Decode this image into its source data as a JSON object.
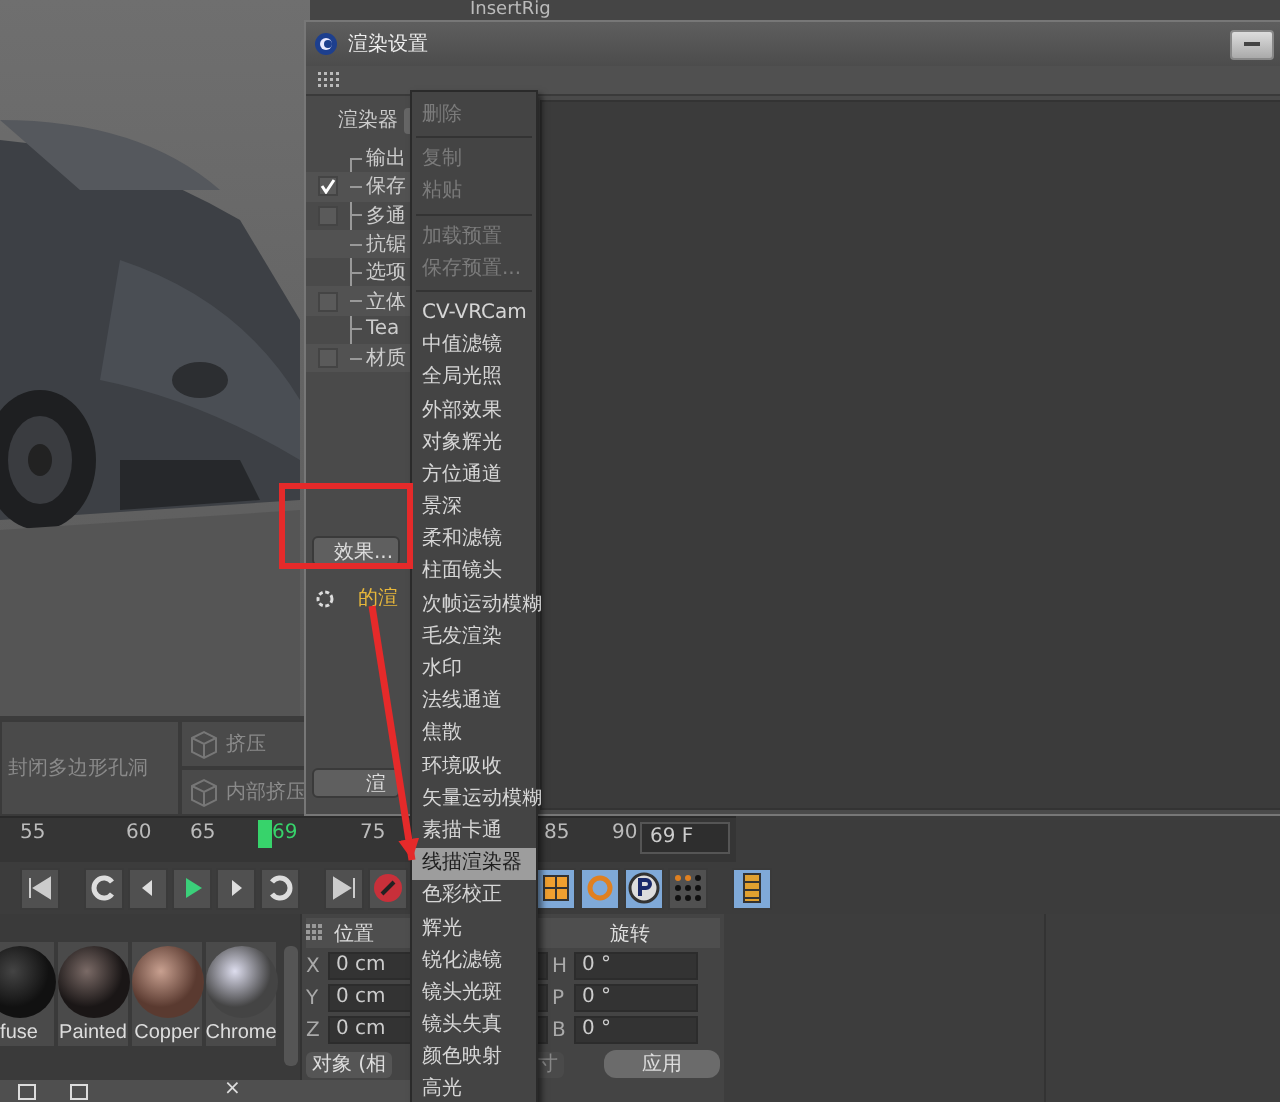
{
  "background_panel": {
    "label": "InsertRig"
  },
  "tool_buttons": [
    {
      "label": "封闭多边形孔洞"
    },
    {
      "label": "挤压"
    },
    {
      "label": "内部挤压"
    }
  ],
  "timeline": {
    "ticks": [
      "55",
      "60",
      "65",
      "75",
      "85",
      "90"
    ],
    "current_frame": "69",
    "frame_field": "69 F"
  },
  "materials": [
    {
      "name": "fuse"
    },
    {
      "name": "Painted"
    },
    {
      "name": "Copper"
    },
    {
      "name": "Chrome"
    }
  ],
  "coordinates": {
    "position_header": "位置",
    "rotation_header": "旋转",
    "position_rows": [
      {
        "axis": "X",
        "value": "0 cm"
      },
      {
        "axis": "Y",
        "value": "0 cm"
      },
      {
        "axis": "Z",
        "value": "0 cm"
      }
    ],
    "rotation_rows": [
      {
        "axis": "H",
        "value": "0 °"
      },
      {
        "axis": "P",
        "value": "0 °"
      },
      {
        "axis": "B",
        "value": "0 °"
      }
    ],
    "mode_dropdown": "对象 (相",
    "size_dropdown": "寸",
    "apply_button": "应用"
  },
  "bottom_tabs": {
    "close": "×"
  },
  "render_settings": {
    "title": "渲染设置",
    "renderer_label": "渲染器",
    "tree": [
      {
        "label": "输出",
        "kind": "plain"
      },
      {
        "label": "保存",
        "kind": "checkbox",
        "checked": true
      },
      {
        "label": "多通",
        "kind": "checkbox",
        "checked": false
      },
      {
        "label": "抗锯",
        "kind": "plain"
      },
      {
        "label": "选项",
        "kind": "plain"
      },
      {
        "label": "立体",
        "kind": "checkbox",
        "checked": false
      },
      {
        "label": "Tea",
        "kind": "plain"
      },
      {
        "label": "材质",
        "kind": "checkbox",
        "checked": false
      }
    ],
    "effect_button": "效果...",
    "effect_item": "的渲",
    "render_button": "渲"
  },
  "context_menu": {
    "items": [
      {
        "label": "删除",
        "disabled": true,
        "selected": false,
        "separator_after": true
      },
      {
        "label": "复制",
        "disabled": true,
        "selected": false,
        "separator_after": false
      },
      {
        "label": "粘贴",
        "disabled": true,
        "selected": false,
        "separator_after": true
      },
      {
        "label": "加载预置",
        "disabled": true,
        "selected": false,
        "separator_after": false
      },
      {
        "label": "保存预置...",
        "disabled": true,
        "selected": false,
        "separator_after": true
      },
      {
        "label": "CV-VRCam",
        "disabled": false,
        "selected": false,
        "separator_after": false
      },
      {
        "label": "中值滤镜",
        "disabled": false,
        "selected": false,
        "separator_after": false
      },
      {
        "label": "全局光照",
        "disabled": false,
        "selected": false,
        "separator_after": false
      },
      {
        "label": "外部效果",
        "disabled": false,
        "selected": false,
        "separator_after": false
      },
      {
        "label": "对象辉光",
        "disabled": false,
        "selected": false,
        "separator_after": false
      },
      {
        "label": "方位通道",
        "disabled": false,
        "selected": false,
        "separator_after": false
      },
      {
        "label": "景深",
        "disabled": false,
        "selected": false,
        "separator_after": false
      },
      {
        "label": "柔和滤镜",
        "disabled": false,
        "selected": false,
        "separator_after": false
      },
      {
        "label": "柱面镜头",
        "disabled": false,
        "selected": false,
        "separator_after": false
      },
      {
        "label": "次帧运动模糊",
        "disabled": false,
        "selected": false,
        "separator_after": false
      },
      {
        "label": "毛发渲染",
        "disabled": false,
        "selected": false,
        "separator_after": false
      },
      {
        "label": "水印",
        "disabled": false,
        "selected": false,
        "separator_after": false
      },
      {
        "label": "法线通道",
        "disabled": false,
        "selected": false,
        "separator_after": false
      },
      {
        "label": "焦散",
        "disabled": false,
        "selected": false,
        "separator_after": false
      },
      {
        "label": "环境吸收",
        "disabled": false,
        "selected": false,
        "separator_after": false
      },
      {
        "label": "矢量运动模糊",
        "disabled": false,
        "selected": false,
        "separator_after": false
      },
      {
        "label": "素描卡通",
        "disabled": false,
        "selected": false,
        "separator_after": false
      },
      {
        "label": "线描渲染器",
        "disabled": false,
        "selected": true,
        "separator_after": false
      },
      {
        "label": "色彩校正",
        "disabled": false,
        "selected": false,
        "separator_after": false
      },
      {
        "label": "辉光",
        "disabled": false,
        "selected": false,
        "separator_after": false
      },
      {
        "label": "锐化滤镜",
        "disabled": false,
        "selected": false,
        "separator_after": false
      },
      {
        "label": "镜头光斑",
        "disabled": false,
        "selected": false,
        "separator_after": false
      },
      {
        "label": "镜头失真",
        "disabled": false,
        "selected": false,
        "separator_after": false
      },
      {
        "label": "颜色映射",
        "disabled": false,
        "selected": false,
        "separator_after": false
      },
      {
        "label": "高光",
        "disabled": false,
        "selected": false,
        "separator_after": false
      }
    ]
  }
}
